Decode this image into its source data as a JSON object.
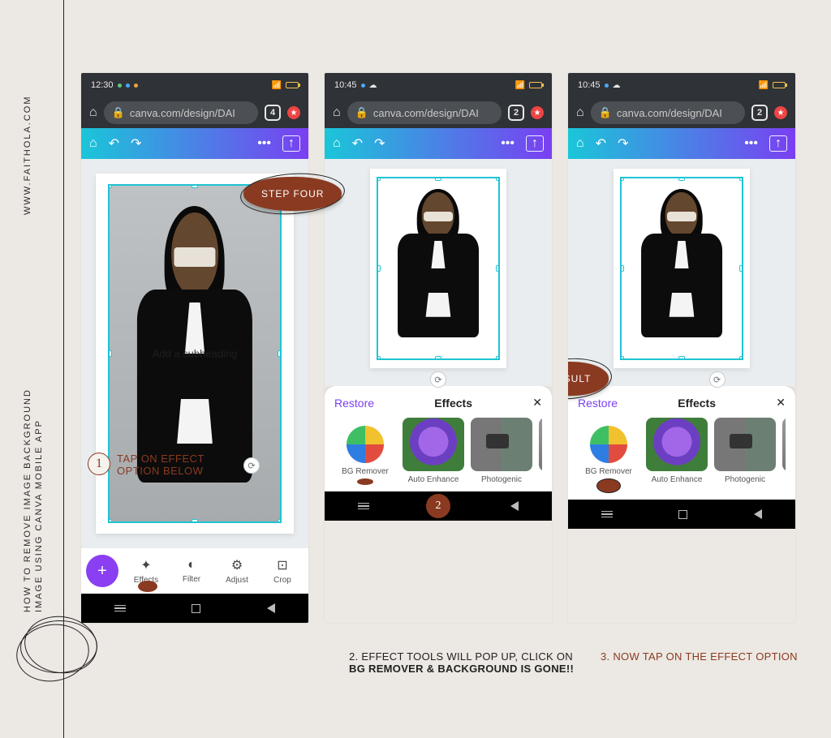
{
  "page": {
    "website": "WWW.FAITHOLA.COM",
    "tutorial_title_line1": "HOW  TO   REMOVE     IMAGE  BACKGROUND",
    "tutorial_title_line2": "IMAGE USING CANVA MOBILE  APP"
  },
  "badges": {
    "step4": "STEP FOUR",
    "result": "RESULT"
  },
  "annotations": {
    "step1_num": "1",
    "step1_text_a": "TAP ON EFFECT",
    "step1_text_b": "OPTION BELOW",
    "step2_num": "2",
    "caption2_a": "2. EFFECT TOOLS WILL POP UP, CLICK ON",
    "caption2_b": "BG REMOVER & BACKGROUND IS GONE!!",
    "caption3": "3. NOW TAP ON THE EFFECT OPTION"
  },
  "common": {
    "url": "canva.com/design/DAI",
    "canvas_overlay": "Add a subheading",
    "rotate_glyph": "⟳",
    "lock_glyph": "🔒",
    "home_glyph": "⌂",
    "undo_glyph": "↶",
    "redo_glyph": "↷",
    "more_glyph": "•••",
    "upload_glyph": "↑",
    "plus": "+",
    "star": "★",
    "cloud": "☁"
  },
  "phone1": {
    "time": "12:30",
    "tab_count": "4",
    "tools": {
      "effects": "Effects",
      "filter": "Filter",
      "adjust": "Adjust",
      "crop": "Crop"
    },
    "tool_icons": {
      "effects": "✦",
      "filter": "◐",
      "adjust": "⚙",
      "crop": "⊡"
    }
  },
  "phone2": {
    "time": "10:45",
    "tab_count": "2"
  },
  "phone3": {
    "time": "10:45",
    "tab_count": "2"
  },
  "effects_panel": {
    "restore": "Restore",
    "title": "Effects",
    "close": "✕",
    "items": {
      "bg_remover": "BG Remover",
      "auto_enhance": "Auto Enhance",
      "photogenic": "Photogenic"
    }
  }
}
